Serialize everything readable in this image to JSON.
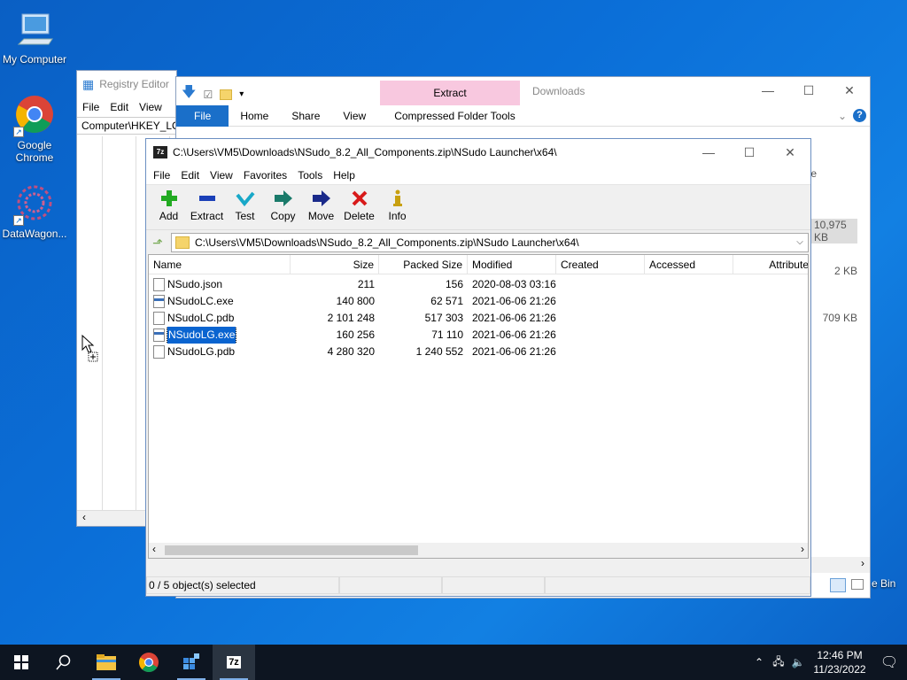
{
  "desktop": {
    "icons": [
      {
        "label": "My Computer",
        "icon": "computer-icon"
      },
      {
        "label": "Google Chrome",
        "icon": "chrome-icon"
      },
      {
        "label": "DataWagon...",
        "icon": "datawagon-icon"
      }
    ],
    "recycle_bin_partial": "e Bin"
  },
  "registry_editor": {
    "title": "Registry Editor",
    "menu": [
      "File",
      "Edit",
      "View"
    ],
    "address": "Computer\\HKEY_LO"
  },
  "explorer": {
    "contextual_tab": "Extract",
    "title": "Downloads",
    "ribbon_tabs": [
      "File",
      "Home",
      "Share",
      "View",
      "Compressed Folder Tools"
    ],
    "partial_column": "e",
    "sizes": [
      "10,975 KB",
      "2 KB",
      "709 KB"
    ]
  },
  "sevenzip": {
    "title": "C:\\Users\\VM5\\Downloads\\NSudo_8.2_All_Components.zip\\NSudo Launcher\\x64\\",
    "app_icon_text": "7z",
    "menu": [
      "File",
      "Edit",
      "View",
      "Favorites",
      "Tools",
      "Help"
    ],
    "toolbar": [
      {
        "label": "Add",
        "icon": "add-icon",
        "color": "#22aa22"
      },
      {
        "label": "Extract",
        "icon": "extract-icon",
        "color": "#1a3fb8"
      },
      {
        "label": "Test",
        "icon": "test-icon",
        "color": "#18a8c8"
      },
      {
        "label": "Copy",
        "icon": "copy-icon",
        "color": "#1a7a6a"
      },
      {
        "label": "Move",
        "icon": "move-icon",
        "color": "#1a2a8a"
      },
      {
        "label": "Delete",
        "icon": "delete-icon",
        "color": "#d81a1a"
      },
      {
        "label": "Info",
        "icon": "info-icon",
        "color": "#c8a010"
      }
    ],
    "address": "C:\\Users\\VM5\\Downloads\\NSudo_8.2_All_Components.zip\\NSudo Launcher\\x64\\",
    "columns": [
      "Name",
      "Size",
      "Packed Size",
      "Modified",
      "Created",
      "Accessed",
      "Attribute"
    ],
    "files": [
      {
        "name": "NSudo.json",
        "size": "211",
        "packed": "156",
        "modified": "2020-08-03 03:16",
        "type": "file",
        "selected": false
      },
      {
        "name": "NSudoLC.exe",
        "size": "140 800",
        "packed": "62 571",
        "modified": "2021-06-06 21:26",
        "type": "exe",
        "selected": false
      },
      {
        "name": "NSudoLC.pdb",
        "size": "2 101 248",
        "packed": "517 303",
        "modified": "2021-06-06 21:26",
        "type": "file",
        "selected": false
      },
      {
        "name": "NSudoLG.exe",
        "size": "160 256",
        "packed": "71 110",
        "modified": "2021-06-06 21:26",
        "type": "exe",
        "selected": true
      },
      {
        "name": "NSudoLG.pdb",
        "size": "4 280 320",
        "packed": "1 240 552",
        "modified": "2021-06-06 21:26",
        "type": "file",
        "selected": false
      }
    ],
    "status": "0 / 5 object(s) selected"
  },
  "taskbar": {
    "apps": [
      "file-explorer-icon",
      "chrome-icon",
      "registry-editor-icon",
      "7zip-icon"
    ],
    "clock_time": "12:46 PM",
    "clock_date": "11/23/2022"
  }
}
